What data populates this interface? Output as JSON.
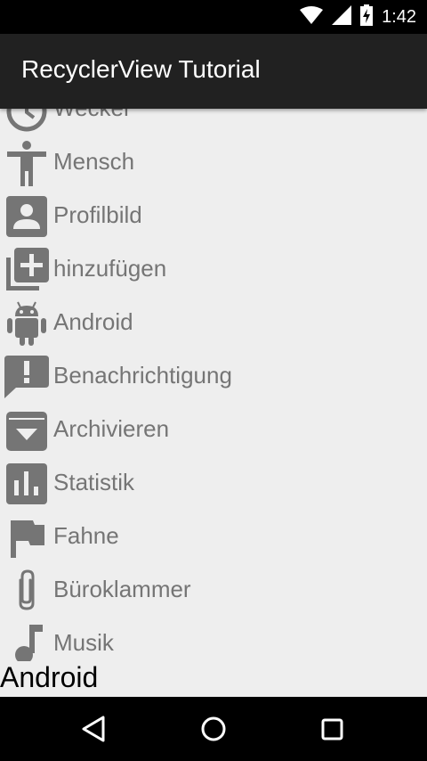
{
  "status_bar": {
    "time": "1:42",
    "icons": [
      "wifi-icon",
      "signal-icon",
      "battery-charging-icon"
    ]
  },
  "action_bar": {
    "title": "RecyclerView Tutorial"
  },
  "list": {
    "items": [
      {
        "label": "Wecker",
        "icon": "alarm-icon"
      },
      {
        "label": "Mensch",
        "icon": "accessibility-icon"
      },
      {
        "label": "Profilbild",
        "icon": "account-box-icon"
      },
      {
        "label": "hinzufügen",
        "icon": "add-to-photos-icon"
      },
      {
        "label": "Android",
        "icon": "android-icon"
      },
      {
        "label": "Benachrichtigung",
        "icon": "announcement-icon"
      },
      {
        "label": "Archivieren",
        "icon": "archive-icon"
      },
      {
        "label": "Statistik",
        "icon": "chart-icon"
      },
      {
        "label": "Fahne",
        "icon": "flag-icon"
      },
      {
        "label": "Büroklammer",
        "icon": "attachment-icon"
      },
      {
        "label": "Musik",
        "icon": "music-note-icon"
      }
    ]
  },
  "footer": {
    "text": "Android"
  },
  "nav_bar": {
    "icons": [
      "back-icon",
      "home-icon",
      "recents-icon"
    ]
  },
  "colors": {
    "status_bar": "#000000",
    "action_bar": "#212121",
    "background": "#eeeeee",
    "icon": "#757575",
    "item_text": "#757575"
  }
}
